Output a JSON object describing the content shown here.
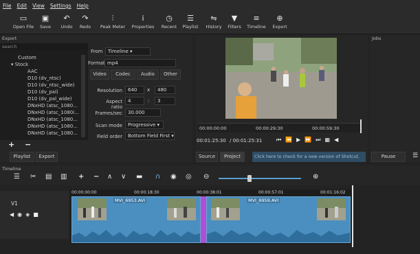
{
  "menu": [
    "File",
    "Edit",
    "View",
    "Settings",
    "Help"
  ],
  "toolbar": [
    {
      "label": "Open File",
      "icon": "folder-icon"
    },
    {
      "label": "Save",
      "icon": "save-icon"
    },
    {
      "label": "Undo",
      "icon": "undo-icon"
    },
    {
      "label": "Redo",
      "icon": "redo-icon"
    },
    {
      "label": "Peak Meter",
      "icon": "peak-meter-icon"
    },
    {
      "label": "Properties",
      "icon": "info-icon"
    },
    {
      "label": "Recent",
      "icon": "clock-icon"
    },
    {
      "label": "Playlist",
      "icon": "list-icon"
    },
    {
      "label": "History",
      "icon": "history-icon"
    },
    {
      "label": "Filters",
      "icon": "filter-icon"
    },
    {
      "label": "Timeline",
      "icon": "timeline-icon"
    },
    {
      "label": "Export",
      "icon": "export-icon"
    }
  ],
  "export": {
    "title": "Export",
    "search_placeholder": "search",
    "tree": [
      "Custom",
      "Stock",
      "AAC",
      "D10 (dv_ntsc)",
      "D10 (dv_ntsc_wide)",
      "D10 (dv_pal)",
      "D10 (dv_pal_wide)",
      "DNxHD (atsc_1080...",
      "DNxHD (atsc_1080i...",
      "DNxHD (atsc_1080...",
      "DNxHD (atsc_1080...",
      "DNxHD (atsc_1080..."
    ],
    "from_label": "From",
    "from_value": "Timeline",
    "format_label": "Format",
    "format_value": "mp4",
    "tabs": [
      "Video",
      "Codec",
      "Audio",
      "Other"
    ],
    "resolution_label": "Resolution",
    "res_w": "640",
    "res_x": "x",
    "res_h": "480",
    "aspect_label": "Aspect ratio",
    "aspect_w": "4",
    "aspect_sep": ":",
    "aspect_h": "3",
    "fps_label": "Frames/sec",
    "fps_value": "30.000",
    "scan_label": "Scan mode",
    "scan_value": "Progressive",
    "field_label": "Field order",
    "field_value": "Bottom Field First",
    "bottom_tabs": [
      "Playlist",
      "Export"
    ]
  },
  "viewer": {
    "ruler": [
      "00:00:00:00",
      "00:00:29:30",
      "00:00:59:30"
    ],
    "current_time": "00:01:25:30",
    "total_time": "/ 00:01:25:31",
    "source_tab": "Source",
    "project_tab": "Project"
  },
  "update_notice": "Click here to check for a new version of Shotcut.",
  "jobs": {
    "title": "Jobs",
    "pause": "Pause"
  },
  "timeline": {
    "title": "Timeline",
    "track_name": "V1",
    "ruler": [
      "00:00:00:00",
      "00:00:18:30",
      "00:00:38:01",
      "00:00:57:01",
      "00:01:16:02"
    ],
    "clips": [
      "MVI_6953.AVI",
      "MVI_6959.AVI"
    ]
  }
}
